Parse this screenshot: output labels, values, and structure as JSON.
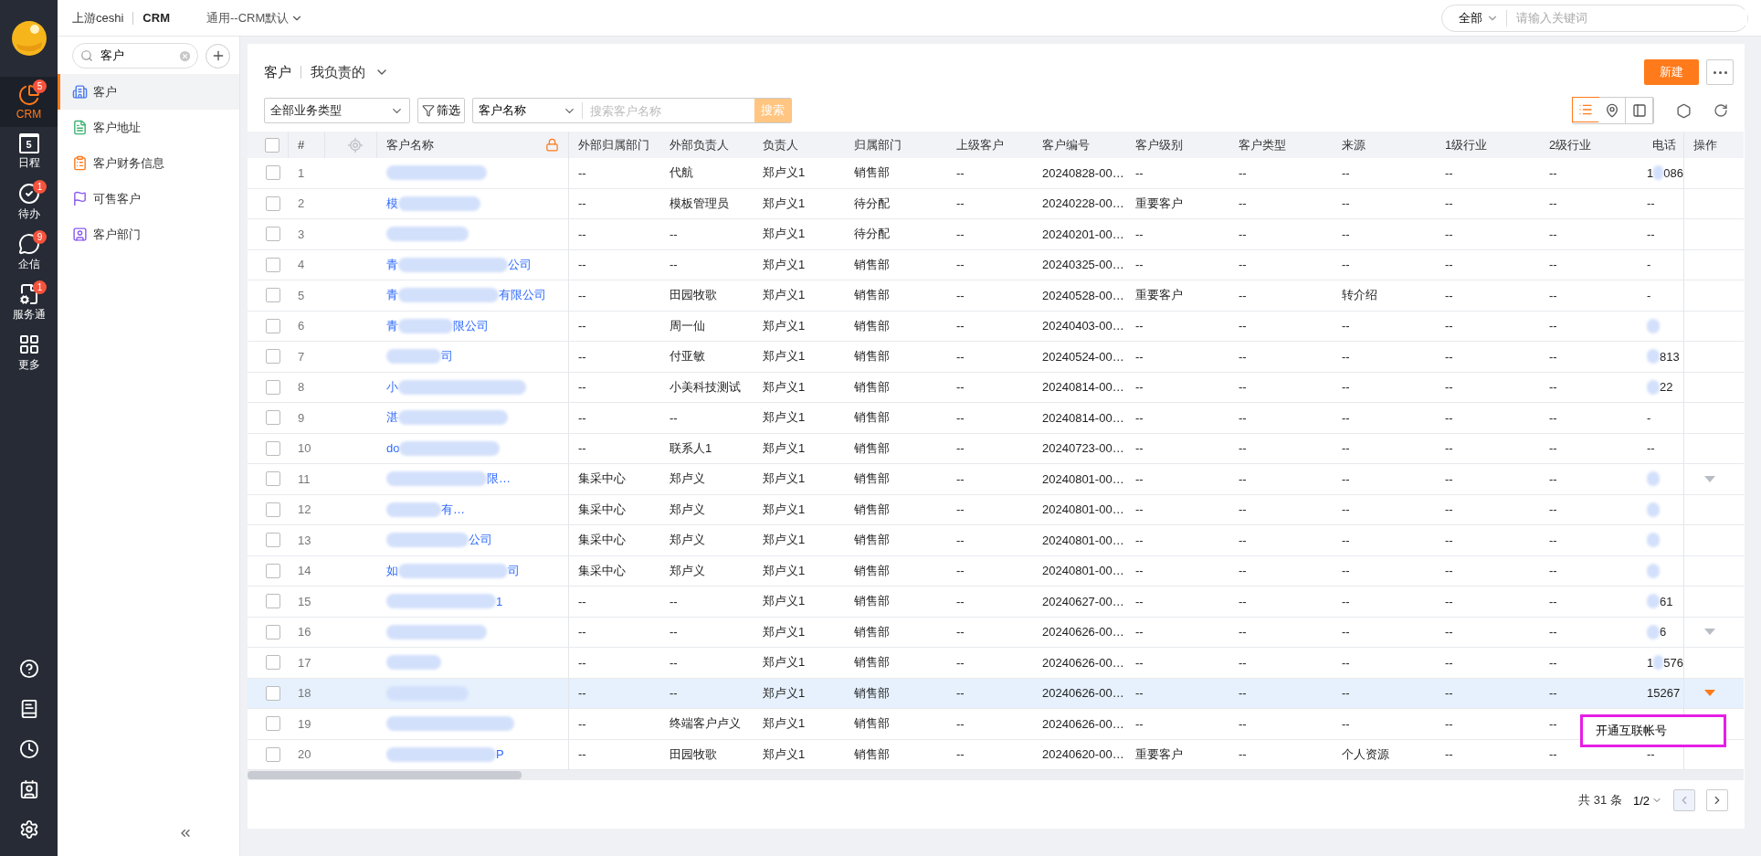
{
  "topbar": {
    "company": "上游ceshi",
    "app": "CRM",
    "view_selector": "通用--CRM默认",
    "search_scope": "全部",
    "search_placeholder": "请输入关键词"
  },
  "rail": {
    "items": [
      {
        "kind": "crm",
        "label": "CRM",
        "badge": "5",
        "selected": true
      },
      {
        "kind": "calendar",
        "label": "日程",
        "day": "5",
        "selected": false
      },
      {
        "kind": "todo",
        "label": "待办",
        "badge": "1",
        "selected": false
      },
      {
        "kind": "chat",
        "label": "企信",
        "badge": "9",
        "selected": false
      },
      {
        "kind": "service",
        "label": "服务通",
        "badge": "1",
        "selected": false
      },
      {
        "kind": "more",
        "label": "更多",
        "selected": false
      }
    ],
    "bottom": [
      {
        "kind": "help"
      },
      {
        "kind": "book"
      },
      {
        "kind": "clock"
      },
      {
        "kind": "contacts"
      },
      {
        "kind": "settings"
      }
    ]
  },
  "sidebar": {
    "search_value": "客户",
    "items": [
      {
        "kind": "building",
        "label": "客户",
        "selected": true
      },
      {
        "kind": "address",
        "label": "客户地址",
        "selected": false
      },
      {
        "kind": "finance",
        "label": "客户财务信息",
        "selected": false
      },
      {
        "kind": "flag",
        "label": "可售客户",
        "selected": false
      },
      {
        "kind": "dept",
        "label": "客户部门",
        "selected": false
      }
    ]
  },
  "header": {
    "title": "客户",
    "scope": "我负责的",
    "new_button": "新建"
  },
  "filters": {
    "type_select": "全部业务类型",
    "filter_button": "筛选",
    "field_select": "客户名称",
    "search_placeholder": "搜索客户名称",
    "search_button": "搜索",
    "views": [
      {
        "kind": "list",
        "selected": true
      },
      {
        "kind": "map",
        "selected": false
      },
      {
        "kind": "panel",
        "selected": false
      }
    ]
  },
  "table": {
    "columns": [
      {
        "kind": "checkbox",
        "checked": false
      },
      {
        "kind": "text",
        "label": "#"
      },
      {
        "kind": "locate"
      },
      {
        "kind": "name",
        "label": "客户名称"
      },
      {
        "kind": "text",
        "label": "外部归属部门"
      },
      {
        "kind": "text",
        "label": "外部负责人"
      },
      {
        "kind": "text",
        "label": "负责人"
      },
      {
        "kind": "text",
        "label": "归属部门"
      },
      {
        "kind": "text",
        "label": "上级客户"
      },
      {
        "kind": "text",
        "label": "客户编号"
      },
      {
        "kind": "text",
        "label": "客户级别"
      },
      {
        "kind": "text",
        "label": "客户类型"
      },
      {
        "kind": "text",
        "label": "来源"
      },
      {
        "kind": "text",
        "label": "1级行业"
      },
      {
        "kind": "text",
        "label": "2级行业"
      },
      {
        "kind": "text",
        "label": "电话"
      },
      {
        "kind": "text",
        "label": "操作"
      }
    ],
    "rows": [
      {
        "hovered": false,
        "cells": [
          {
            "kind": "checkbox",
            "checked": false
          },
          {
            "kind": "number",
            "text": "1"
          },
          {
            "kind": "blank"
          },
          {
            "kind": "name",
            "parts": [
              {
                "kind": "blur"
              }
            ]
          },
          {
            "kind": "text",
            "text": "--"
          },
          {
            "kind": "text",
            "text": "代航"
          },
          {
            "kind": "text",
            "text": "郑卢义1"
          },
          {
            "kind": "text",
            "text": "销售部"
          },
          {
            "kind": "text",
            "text": "--"
          },
          {
            "kind": "text",
            "text": "20240828-00…"
          },
          {
            "kind": "text",
            "text": "--"
          },
          {
            "kind": "text",
            "text": "--"
          },
          {
            "kind": "text",
            "text": "--"
          },
          {
            "kind": "text",
            "text": "--"
          },
          {
            "kind": "text",
            "text": "--"
          },
          {
            "kind": "phone",
            "parts": [
              {
                "kind": "text",
                "text": "1"
              },
              {
                "kind": "blur"
              },
              {
                "kind": "text",
                "text": "086"
              }
            ]
          },
          {
            "kind": "action",
            "caret": false
          }
        ]
      },
      {
        "hovered": false,
        "cells": [
          {
            "kind": "checkbox",
            "checked": false
          },
          {
            "kind": "number",
            "text": "2"
          },
          {
            "kind": "blank"
          },
          {
            "kind": "name",
            "parts": [
              {
                "kind": "text",
                "text": "模"
              },
              {
                "kind": "blur"
              }
            ]
          },
          {
            "kind": "text",
            "text": "--"
          },
          {
            "kind": "text",
            "text": "模板管理员"
          },
          {
            "kind": "text",
            "text": "郑卢义1"
          },
          {
            "kind": "text",
            "text": "待分配"
          },
          {
            "kind": "text",
            "text": "--"
          },
          {
            "kind": "text",
            "text": "20240228-00…"
          },
          {
            "kind": "text",
            "text": "重要客户"
          },
          {
            "kind": "text",
            "text": "--"
          },
          {
            "kind": "text",
            "text": "--"
          },
          {
            "kind": "text",
            "text": "--"
          },
          {
            "kind": "text",
            "text": "--"
          },
          {
            "kind": "phone",
            "parts": [
              {
                "kind": "text",
                "text": "--"
              }
            ]
          },
          {
            "kind": "action",
            "caret": false
          }
        ]
      },
      {
        "hovered": false,
        "cells": [
          {
            "kind": "checkbox",
            "checked": false
          },
          {
            "kind": "number",
            "text": "3"
          },
          {
            "kind": "blank"
          },
          {
            "kind": "name",
            "parts": [
              {
                "kind": "blur"
              }
            ]
          },
          {
            "kind": "text",
            "text": "--"
          },
          {
            "kind": "text",
            "text": "--"
          },
          {
            "kind": "text",
            "text": "郑卢义1"
          },
          {
            "kind": "text",
            "text": "待分配"
          },
          {
            "kind": "text",
            "text": "--"
          },
          {
            "kind": "text",
            "text": "20240201-00…"
          },
          {
            "kind": "text",
            "text": "--"
          },
          {
            "kind": "text",
            "text": "--"
          },
          {
            "kind": "text",
            "text": "--"
          },
          {
            "kind": "text",
            "text": "--"
          },
          {
            "kind": "text",
            "text": "--"
          },
          {
            "kind": "phone",
            "parts": [
              {
                "kind": "text",
                "text": "--"
              }
            ]
          },
          {
            "kind": "action",
            "caret": false
          }
        ]
      },
      {
        "hovered": false,
        "cells": [
          {
            "kind": "checkbox",
            "checked": false
          },
          {
            "kind": "number",
            "text": "4"
          },
          {
            "kind": "blank"
          },
          {
            "kind": "name",
            "parts": [
              {
                "kind": "text",
                "text": "青"
              },
              {
                "kind": "blur"
              },
              {
                "kind": "text",
                "text": "公司"
              }
            ]
          },
          {
            "kind": "text",
            "text": "--"
          },
          {
            "kind": "text",
            "text": "--"
          },
          {
            "kind": "text",
            "text": "郑卢义1"
          },
          {
            "kind": "text",
            "text": "销售部"
          },
          {
            "kind": "text",
            "text": "--"
          },
          {
            "kind": "text",
            "text": "20240325-00…"
          },
          {
            "kind": "text",
            "text": "--"
          },
          {
            "kind": "text",
            "text": "--"
          },
          {
            "kind": "text",
            "text": "--"
          },
          {
            "kind": "text",
            "text": "--"
          },
          {
            "kind": "text",
            "text": "--"
          },
          {
            "kind": "phone",
            "parts": [
              {
                "kind": "text",
                "text": "-"
              }
            ]
          },
          {
            "kind": "action",
            "caret": false
          }
        ]
      },
      {
        "hovered": false,
        "cells": [
          {
            "kind": "checkbox",
            "checked": false
          },
          {
            "kind": "number",
            "text": "5"
          },
          {
            "kind": "blank"
          },
          {
            "kind": "name",
            "parts": [
              {
                "kind": "text",
                "text": "青"
              },
              {
                "kind": "blur"
              },
              {
                "kind": "text",
                "text": "有限公司"
              }
            ]
          },
          {
            "kind": "text",
            "text": "--"
          },
          {
            "kind": "text",
            "text": "田园牧歌"
          },
          {
            "kind": "text",
            "text": "郑卢义1"
          },
          {
            "kind": "text",
            "text": "销售部"
          },
          {
            "kind": "text",
            "text": "--"
          },
          {
            "kind": "text",
            "text": "20240528-00…"
          },
          {
            "kind": "text",
            "text": "重要客户"
          },
          {
            "kind": "text",
            "text": "--"
          },
          {
            "kind": "text",
            "text": "转介绍"
          },
          {
            "kind": "text",
            "text": "--"
          },
          {
            "kind": "text",
            "text": "--"
          },
          {
            "kind": "phone",
            "parts": [
              {
                "kind": "text",
                "text": "-"
              }
            ]
          },
          {
            "kind": "action",
            "caret": false
          }
        ]
      },
      {
        "hovered": false,
        "cells": [
          {
            "kind": "checkbox",
            "checked": false
          },
          {
            "kind": "number",
            "text": "6"
          },
          {
            "kind": "blank"
          },
          {
            "kind": "name",
            "parts": [
              {
                "kind": "text",
                "text": "青"
              },
              {
                "kind": "blur"
              },
              {
                "kind": "text",
                "text": "限公司"
              }
            ]
          },
          {
            "kind": "text",
            "text": "--"
          },
          {
            "kind": "text",
            "text": "周一仙"
          },
          {
            "kind": "text",
            "text": "郑卢义1"
          },
          {
            "kind": "text",
            "text": "销售部"
          },
          {
            "kind": "text",
            "text": "--"
          },
          {
            "kind": "text",
            "text": "20240403-00…"
          },
          {
            "kind": "text",
            "text": "--"
          },
          {
            "kind": "text",
            "text": "--"
          },
          {
            "kind": "text",
            "text": "--"
          },
          {
            "kind": "text",
            "text": "--"
          },
          {
            "kind": "text",
            "text": "--"
          },
          {
            "kind": "phone",
            "parts": [
              {
                "kind": "blur"
              }
            ]
          },
          {
            "kind": "action",
            "caret": false
          }
        ]
      },
      {
        "hovered": false,
        "cells": [
          {
            "kind": "checkbox",
            "checked": false
          },
          {
            "kind": "number",
            "text": "7"
          },
          {
            "kind": "blank"
          },
          {
            "kind": "name",
            "parts": [
              {
                "kind": "blur"
              },
              {
                "kind": "text",
                "text": "司"
              }
            ]
          },
          {
            "kind": "text",
            "text": "--"
          },
          {
            "kind": "text",
            "text": "付亚敏"
          },
          {
            "kind": "text",
            "text": "郑卢义1"
          },
          {
            "kind": "text",
            "text": "销售部"
          },
          {
            "kind": "text",
            "text": "--"
          },
          {
            "kind": "text",
            "text": "20240524-00…"
          },
          {
            "kind": "text",
            "text": "--"
          },
          {
            "kind": "text",
            "text": "--"
          },
          {
            "kind": "text",
            "text": "--"
          },
          {
            "kind": "text",
            "text": "--"
          },
          {
            "kind": "text",
            "text": "--"
          },
          {
            "kind": "phone",
            "parts": [
              {
                "kind": "blur"
              },
              {
                "kind": "text",
                "text": "813"
              }
            ]
          },
          {
            "kind": "action",
            "caret": false
          }
        ]
      },
      {
        "hovered": false,
        "cells": [
          {
            "kind": "checkbox",
            "checked": false
          },
          {
            "kind": "number",
            "text": "8"
          },
          {
            "kind": "blank"
          },
          {
            "kind": "name",
            "parts": [
              {
                "kind": "text",
                "text": "小"
              },
              {
                "kind": "blur"
              }
            ]
          },
          {
            "kind": "text",
            "text": "--"
          },
          {
            "kind": "text",
            "text": "小美科技测试"
          },
          {
            "kind": "text",
            "text": "郑卢义1"
          },
          {
            "kind": "text",
            "text": "销售部"
          },
          {
            "kind": "text",
            "text": "--"
          },
          {
            "kind": "text",
            "text": "20240814-00…"
          },
          {
            "kind": "text",
            "text": "--"
          },
          {
            "kind": "text",
            "text": "--"
          },
          {
            "kind": "text",
            "text": "--"
          },
          {
            "kind": "text",
            "text": "--"
          },
          {
            "kind": "text",
            "text": "--"
          },
          {
            "kind": "phone",
            "parts": [
              {
                "kind": "blur"
              },
              {
                "kind": "text",
                "text": "22"
              }
            ]
          },
          {
            "kind": "action",
            "caret": false
          }
        ]
      },
      {
        "hovered": false,
        "cells": [
          {
            "kind": "checkbox",
            "checked": false
          },
          {
            "kind": "number",
            "text": "9"
          },
          {
            "kind": "blank"
          },
          {
            "kind": "name",
            "parts": [
              {
                "kind": "text",
                "text": "湛"
              },
              {
                "kind": "blur"
              }
            ]
          },
          {
            "kind": "text",
            "text": "--"
          },
          {
            "kind": "text",
            "text": "--"
          },
          {
            "kind": "text",
            "text": "郑卢义1"
          },
          {
            "kind": "text",
            "text": "销售部"
          },
          {
            "kind": "text",
            "text": "--"
          },
          {
            "kind": "text",
            "text": "20240814-00…"
          },
          {
            "kind": "text",
            "text": "--"
          },
          {
            "kind": "text",
            "text": "--"
          },
          {
            "kind": "text",
            "text": "--"
          },
          {
            "kind": "text",
            "text": "--"
          },
          {
            "kind": "text",
            "text": "--"
          },
          {
            "kind": "phone",
            "parts": [
              {
                "kind": "text",
                "text": "-"
              }
            ]
          },
          {
            "kind": "action",
            "caret": false
          }
        ]
      },
      {
        "hovered": false,
        "cells": [
          {
            "kind": "checkbox",
            "checked": false
          },
          {
            "kind": "number",
            "text": "10"
          },
          {
            "kind": "blank"
          },
          {
            "kind": "name",
            "parts": [
              {
                "kind": "text",
                "text": "do"
              },
              {
                "kind": "blur"
              }
            ]
          },
          {
            "kind": "text",
            "text": "--"
          },
          {
            "kind": "text",
            "text": "联系人1"
          },
          {
            "kind": "text",
            "text": "郑卢义1"
          },
          {
            "kind": "text",
            "text": "销售部"
          },
          {
            "kind": "text",
            "text": "--"
          },
          {
            "kind": "text",
            "text": "20240723-00…"
          },
          {
            "kind": "text",
            "text": "--"
          },
          {
            "kind": "text",
            "text": "--"
          },
          {
            "kind": "text",
            "text": "--"
          },
          {
            "kind": "text",
            "text": "--"
          },
          {
            "kind": "text",
            "text": "--"
          },
          {
            "kind": "phone",
            "parts": [
              {
                "kind": "text",
                "text": "--"
              }
            ]
          },
          {
            "kind": "action",
            "caret": false
          }
        ]
      },
      {
        "hovered": false,
        "cells": [
          {
            "kind": "checkbox",
            "checked": false
          },
          {
            "kind": "number",
            "text": "11"
          },
          {
            "kind": "blank"
          },
          {
            "kind": "name",
            "parts": [
              {
                "kind": "blur"
              },
              {
                "kind": "text",
                "text": "限…"
              }
            ]
          },
          {
            "kind": "text",
            "text": "集采中心"
          },
          {
            "kind": "text",
            "text": "郑卢义"
          },
          {
            "kind": "text",
            "text": "郑卢义1"
          },
          {
            "kind": "text",
            "text": "销售部"
          },
          {
            "kind": "text",
            "text": "--"
          },
          {
            "kind": "text",
            "text": "20240801-00…"
          },
          {
            "kind": "text",
            "text": "--"
          },
          {
            "kind": "text",
            "text": "--"
          },
          {
            "kind": "text",
            "text": "--"
          },
          {
            "kind": "text",
            "text": "--"
          },
          {
            "kind": "text",
            "text": "--"
          },
          {
            "kind": "phone",
            "parts": [
              {
                "kind": "blur"
              }
            ]
          },
          {
            "kind": "action",
            "caret": true
          }
        ]
      },
      {
        "hovered": false,
        "cells": [
          {
            "kind": "checkbox",
            "checked": false
          },
          {
            "kind": "number",
            "text": "12"
          },
          {
            "kind": "blank"
          },
          {
            "kind": "name",
            "parts": [
              {
                "kind": "blur"
              },
              {
                "kind": "text",
                "text": "有…"
              }
            ]
          },
          {
            "kind": "text",
            "text": "集采中心"
          },
          {
            "kind": "text",
            "text": "郑卢义"
          },
          {
            "kind": "text",
            "text": "郑卢义1"
          },
          {
            "kind": "text",
            "text": "销售部"
          },
          {
            "kind": "text",
            "text": "--"
          },
          {
            "kind": "text",
            "text": "20240801-00…"
          },
          {
            "kind": "text",
            "text": "--"
          },
          {
            "kind": "text",
            "text": "--"
          },
          {
            "kind": "text",
            "text": "--"
          },
          {
            "kind": "text",
            "text": "--"
          },
          {
            "kind": "text",
            "text": "--"
          },
          {
            "kind": "phone",
            "parts": [
              {
                "kind": "blur"
              }
            ]
          },
          {
            "kind": "action",
            "caret": false
          }
        ]
      },
      {
        "hovered": false,
        "cells": [
          {
            "kind": "checkbox",
            "checked": false
          },
          {
            "kind": "number",
            "text": "13"
          },
          {
            "kind": "blank"
          },
          {
            "kind": "name",
            "parts": [
              {
                "kind": "blur"
              },
              {
                "kind": "text",
                "text": "公司"
              }
            ]
          },
          {
            "kind": "text",
            "text": "集采中心"
          },
          {
            "kind": "text",
            "text": "郑卢义"
          },
          {
            "kind": "text",
            "text": "郑卢义1"
          },
          {
            "kind": "text",
            "text": "销售部"
          },
          {
            "kind": "text",
            "text": "--"
          },
          {
            "kind": "text",
            "text": "20240801-00…"
          },
          {
            "kind": "text",
            "text": "--"
          },
          {
            "kind": "text",
            "text": "--"
          },
          {
            "kind": "text",
            "text": "--"
          },
          {
            "kind": "text",
            "text": "--"
          },
          {
            "kind": "text",
            "text": "--"
          },
          {
            "kind": "phone",
            "parts": [
              {
                "kind": "blur"
              }
            ]
          },
          {
            "kind": "action",
            "caret": false
          }
        ]
      },
      {
        "hovered": false,
        "cells": [
          {
            "kind": "checkbox",
            "checked": false
          },
          {
            "kind": "number",
            "text": "14"
          },
          {
            "kind": "blank"
          },
          {
            "kind": "name",
            "parts": [
              {
                "kind": "text",
                "text": "如"
              },
              {
                "kind": "blur"
              },
              {
                "kind": "text",
                "text": "司"
              }
            ]
          },
          {
            "kind": "text",
            "text": "集采中心"
          },
          {
            "kind": "text",
            "text": "郑卢义"
          },
          {
            "kind": "text",
            "text": "郑卢义1"
          },
          {
            "kind": "text",
            "text": "销售部"
          },
          {
            "kind": "text",
            "text": "--"
          },
          {
            "kind": "text",
            "text": "20240801-00…"
          },
          {
            "kind": "text",
            "text": "--"
          },
          {
            "kind": "text",
            "text": "--"
          },
          {
            "kind": "text",
            "text": "--"
          },
          {
            "kind": "text",
            "text": "--"
          },
          {
            "kind": "text",
            "text": "--"
          },
          {
            "kind": "phone",
            "parts": [
              {
                "kind": "blur"
              }
            ]
          },
          {
            "kind": "action",
            "caret": false
          }
        ]
      },
      {
        "hovered": false,
        "cells": [
          {
            "kind": "checkbox",
            "checked": false
          },
          {
            "kind": "number",
            "text": "15"
          },
          {
            "kind": "blank"
          },
          {
            "kind": "name",
            "parts": [
              {
                "kind": "blur"
              },
              {
                "kind": "text",
                "text": "1"
              }
            ]
          },
          {
            "kind": "text",
            "text": "--"
          },
          {
            "kind": "text",
            "text": "--"
          },
          {
            "kind": "text",
            "text": "郑卢义1"
          },
          {
            "kind": "text",
            "text": "销售部"
          },
          {
            "kind": "text",
            "text": "--"
          },
          {
            "kind": "text",
            "text": "20240627-00…"
          },
          {
            "kind": "text",
            "text": "--"
          },
          {
            "kind": "text",
            "text": "--"
          },
          {
            "kind": "text",
            "text": "--"
          },
          {
            "kind": "text",
            "text": "--"
          },
          {
            "kind": "text",
            "text": "--"
          },
          {
            "kind": "phone",
            "parts": [
              {
                "kind": "blur"
              },
              {
                "kind": "text",
                "text": "61"
              }
            ]
          },
          {
            "kind": "action",
            "caret": false
          }
        ]
      },
      {
        "hovered": false,
        "cells": [
          {
            "kind": "checkbox",
            "checked": false
          },
          {
            "kind": "number",
            "text": "16"
          },
          {
            "kind": "blank"
          },
          {
            "kind": "name",
            "parts": [
              {
                "kind": "blur"
              }
            ]
          },
          {
            "kind": "text",
            "text": "--"
          },
          {
            "kind": "text",
            "text": "--"
          },
          {
            "kind": "text",
            "text": "郑卢义1"
          },
          {
            "kind": "text",
            "text": "销售部"
          },
          {
            "kind": "text",
            "text": "--"
          },
          {
            "kind": "text",
            "text": "20240626-00…"
          },
          {
            "kind": "text",
            "text": "--"
          },
          {
            "kind": "text",
            "text": "--"
          },
          {
            "kind": "text",
            "text": "--"
          },
          {
            "kind": "text",
            "text": "--"
          },
          {
            "kind": "text",
            "text": "--"
          },
          {
            "kind": "phone",
            "parts": [
              {
                "kind": "blur"
              },
              {
                "kind": "text",
                "text": "6"
              }
            ]
          },
          {
            "kind": "action",
            "caret": true
          }
        ]
      },
      {
        "hovered": false,
        "cells": [
          {
            "kind": "checkbox",
            "checked": false
          },
          {
            "kind": "number",
            "text": "17"
          },
          {
            "kind": "blank"
          },
          {
            "kind": "name",
            "parts": [
              {
                "kind": "blur"
              }
            ]
          },
          {
            "kind": "text",
            "text": "--"
          },
          {
            "kind": "text",
            "text": "--"
          },
          {
            "kind": "text",
            "text": "郑卢义1"
          },
          {
            "kind": "text",
            "text": "销售部"
          },
          {
            "kind": "text",
            "text": "--"
          },
          {
            "kind": "text",
            "text": "20240626-00…"
          },
          {
            "kind": "text",
            "text": "--"
          },
          {
            "kind": "text",
            "text": "--"
          },
          {
            "kind": "text",
            "text": "--"
          },
          {
            "kind": "text",
            "text": "--"
          },
          {
            "kind": "text",
            "text": "--"
          },
          {
            "kind": "phone",
            "parts": [
              {
                "kind": "text",
                "text": "1"
              },
              {
                "kind": "blur"
              },
              {
                "kind": "text",
                "text": "576"
              }
            ]
          },
          {
            "kind": "action",
            "caret": false
          }
        ]
      },
      {
        "hovered": true,
        "cells": [
          {
            "kind": "checkbox",
            "checked": false
          },
          {
            "kind": "number",
            "text": "18"
          },
          {
            "kind": "blank"
          },
          {
            "kind": "name",
            "parts": [
              {
                "kind": "blur"
              }
            ]
          },
          {
            "kind": "text",
            "text": "--"
          },
          {
            "kind": "text",
            "text": "--"
          },
          {
            "kind": "text",
            "text": "郑卢义1"
          },
          {
            "kind": "text",
            "text": "销售部"
          },
          {
            "kind": "text",
            "text": "--"
          },
          {
            "kind": "text",
            "text": "20240626-00…"
          },
          {
            "kind": "text",
            "text": "--"
          },
          {
            "kind": "text",
            "text": "--"
          },
          {
            "kind": "text",
            "text": "--"
          },
          {
            "kind": "text",
            "text": "--"
          },
          {
            "kind": "text",
            "text": "--"
          },
          {
            "kind": "phone",
            "parts": [
              {
                "kind": "text",
                "text": "15267"
              }
            ]
          },
          {
            "kind": "action",
            "caret": true
          }
        ]
      },
      {
        "hovered": false,
        "cells": [
          {
            "kind": "checkbox",
            "checked": false
          },
          {
            "kind": "number",
            "text": "19"
          },
          {
            "kind": "blank"
          },
          {
            "kind": "name",
            "parts": [
              {
                "kind": "blur"
              }
            ]
          },
          {
            "kind": "text",
            "text": "--"
          },
          {
            "kind": "text",
            "text": "终端客户卢义"
          },
          {
            "kind": "text",
            "text": "郑卢义1"
          },
          {
            "kind": "text",
            "text": "销售部"
          },
          {
            "kind": "text",
            "text": "--"
          },
          {
            "kind": "text",
            "text": "20240626-00…"
          },
          {
            "kind": "text",
            "text": "--"
          },
          {
            "kind": "text",
            "text": "--"
          },
          {
            "kind": "text",
            "text": "--"
          },
          {
            "kind": "text",
            "text": "--"
          },
          {
            "kind": "text",
            "text": "--"
          },
          {
            "kind": "blank"
          },
          {
            "kind": "action"
          }
        ]
      },
      {
        "hovered": false,
        "cells": [
          {
            "kind": "checkbox",
            "checked": false
          },
          {
            "kind": "number",
            "text": "20"
          },
          {
            "kind": "blank"
          },
          {
            "kind": "name",
            "parts": [
              {
                "kind": "blur"
              },
              {
                "kind": "text",
                "text": "P"
              }
            ]
          },
          {
            "kind": "text",
            "text": "--"
          },
          {
            "kind": "text",
            "text": "田园牧歌"
          },
          {
            "kind": "text",
            "text": "郑卢义1"
          },
          {
            "kind": "text",
            "text": "销售部"
          },
          {
            "kind": "text",
            "text": "--"
          },
          {
            "kind": "text",
            "text": "20240620-00…"
          },
          {
            "kind": "text",
            "text": "重要客户"
          },
          {
            "kind": "text",
            "text": "--"
          },
          {
            "kind": "text",
            "text": "个人资源"
          },
          {
            "kind": "text",
            "text": "--"
          },
          {
            "kind": "text",
            "text": "--"
          },
          {
            "kind": "phone",
            "parts": [
              {
                "kind": "text",
                "text": "--"
              }
            ]
          },
          {
            "kind": "action",
            "caret": false
          }
        ]
      }
    ]
  },
  "row_menu": {
    "items": [
      "开通互联帐号"
    ]
  },
  "pagination": {
    "total": "共 31 条",
    "page": "1/2"
  }
}
